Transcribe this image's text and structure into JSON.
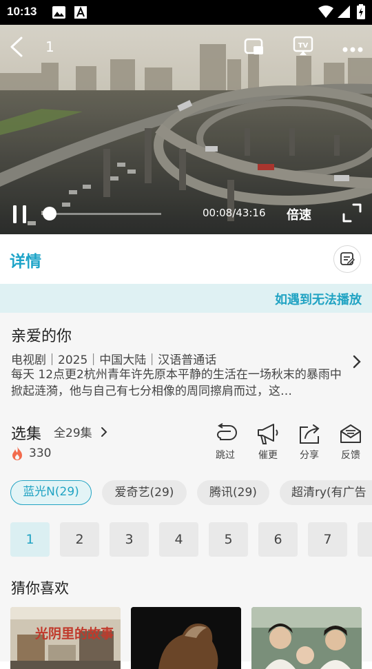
{
  "status_bar": {
    "time": "10:13"
  },
  "player": {
    "episode": "1",
    "time": "00:08/43:16",
    "speed_label": "倍速",
    "progress": 0.003
  },
  "details": {
    "title": "详情"
  },
  "notice": {
    "text": "如遇到无法播放"
  },
  "show": {
    "title": "亲爱的你",
    "meta": "电视剧｜2025｜中国大陆｜汉语普通话",
    "description": "每天 12点更2杭州青年许先原本平静的生活在一场秋末的暴雨中掀起涟漪，他与自己有七分相像的周同擦肩而过，这…"
  },
  "episodes": {
    "title": "选集",
    "count": "全29集",
    "heat": "330",
    "actions": [
      {
        "label": "跳过",
        "icon": "skip-icon"
      },
      {
        "label": "催更",
        "icon": "megaphone-icon"
      },
      {
        "label": "分享",
        "icon": "share-icon"
      },
      {
        "label": "反馈",
        "icon": "feedback-icon"
      }
    ],
    "sources": [
      "蓝光N(29)",
      "爱奇艺(29)",
      "腾讯(29)",
      "超清ry(有广告"
    ],
    "numbers": [
      "1",
      "2",
      "3",
      "4",
      "5",
      "6",
      "7"
    ],
    "selected": "1"
  },
  "recommend": {
    "title": "猜你喜欢",
    "card1_text": "光阴里的故事"
  },
  "colors": {
    "accent": "#21a3c3",
    "notice_bg": "#dff1f3"
  }
}
